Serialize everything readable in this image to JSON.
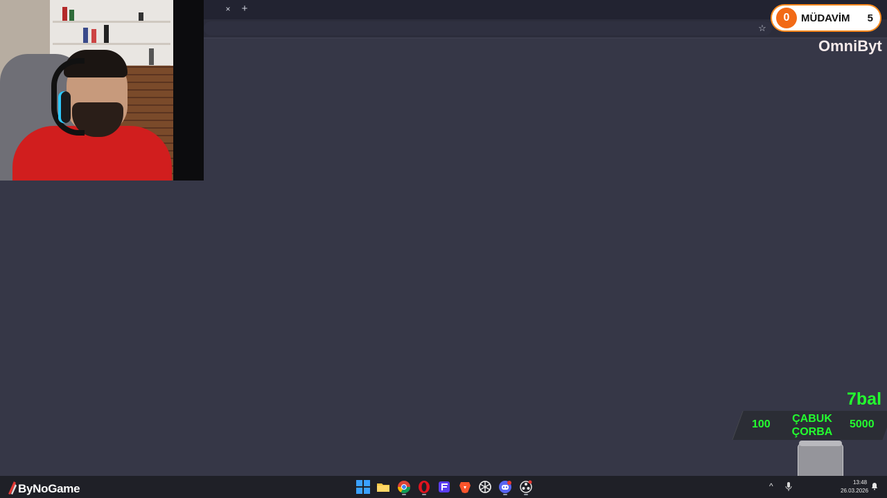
{
  "browser": {
    "tab_close_glyph": "×",
    "new_tab_glyph": "+",
    "bookmark_glyph": "☆"
  },
  "webcam": {
    "description_icon": "webcam-feed"
  },
  "overlay": {
    "badge": {
      "left_count": "0",
      "label": "MÜDAVİM",
      "right_count": "5"
    },
    "ticker_name": "OmniByt",
    "ticker_goal": "7bal",
    "goal": {
      "min": "100",
      "title_line1": "ÇABUK",
      "title_line2": "ÇORBA",
      "max": "5000"
    },
    "colors": {
      "accent_green": "#23ff2f",
      "badge_orange": "#f26a16"
    }
  },
  "taskbar": {
    "brand": "ByNoGame",
    "icons": [
      "windows-start-icon",
      "file-explorer-icon",
      "chrome-icon",
      "opera-icon",
      "fuel-icon",
      "brave-icon",
      "openai-icon",
      "discord-icon",
      "obs-icon"
    ],
    "tray_chevron": "^",
    "time": "13:48",
    "date": "26.03.2026"
  }
}
